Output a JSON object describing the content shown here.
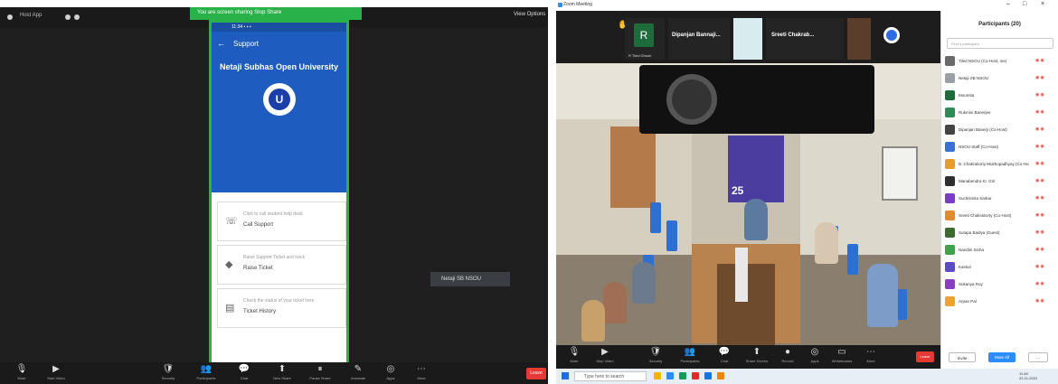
{
  "left": {
    "window_title": "Host App",
    "share_banner": "You are screen sharing   Stop Share",
    "view_label": "View Options",
    "phone": {
      "header_title": "Support",
      "university": "Netaji Subhas Open University",
      "logo_letter": "U",
      "cards": [
        {
          "icon": "phone-icon",
          "label": "Click to call student help desk",
          "value": "Call Support"
        },
        {
          "icon": "ticket-icon",
          "label": "Raise Support Ticket and track",
          "value": "Raise Ticket"
        },
        {
          "icon": "book-icon",
          "label": "Check the status of your ticket here",
          "value": "Ticket History"
        }
      ]
    },
    "name_tag": "Netaji SB NSOU",
    "toolbar": [
      {
        "name": "unmute",
        "glyph": "🎙",
        "label": "Mute"
      },
      {
        "name": "video",
        "glyph": "▶",
        "label": "Start Video"
      },
      {
        "name": "security",
        "glyph": "🛡",
        "label": "Security"
      },
      {
        "name": "participants",
        "glyph": "👥",
        "label": "Participants"
      },
      {
        "name": "chat",
        "glyph": "💬",
        "label": "Chat"
      },
      {
        "name": "new-share",
        "glyph": "⬆",
        "label": "New Share"
      },
      {
        "name": "pause-share",
        "glyph": "⏸",
        "label": "Pause Share"
      },
      {
        "name": "annotate",
        "glyph": "✎",
        "label": "Annotate"
      },
      {
        "name": "apps",
        "glyph": "◎",
        "label": "Apps"
      },
      {
        "name": "more",
        "glyph": "⋯",
        "label": "More"
      }
    ],
    "end_label": "Leave"
  },
  "right": {
    "window_title": "Zoom Meeting",
    "strip": [
      {
        "name": "R Tiled Ghosh",
        "initial": "R",
        "color": "#1e6b3c"
      },
      {
        "name": "Dipanjan Bannaji...",
        "big": "Dipanjan Bannaji..."
      },
      {
        "name": "Sreeti Chakrab...",
        "big": "Sreeti Chakrab..."
      }
    ],
    "banner_number": "25",
    "toolbar": [
      {
        "name": "mute",
        "glyph": "🎙",
        "label": "Mute"
      },
      {
        "name": "video",
        "glyph": "▶",
        "label": "Stop Video"
      },
      {
        "name": "security",
        "glyph": "🛡",
        "label": "Security"
      },
      {
        "name": "participants",
        "glyph": "👥",
        "label": "Participants"
      },
      {
        "name": "chat",
        "glyph": "💬",
        "label": "Chat"
      },
      {
        "name": "share",
        "glyph": "⬆",
        "label": "Share Screen"
      },
      {
        "name": "record",
        "glyph": "●",
        "label": "Record"
      },
      {
        "name": "apps",
        "glyph": "◎",
        "label": "Apps"
      },
      {
        "name": "whiteboard",
        "glyph": "▭",
        "label": "Whiteboards"
      },
      {
        "name": "more",
        "glyph": "⋯",
        "label": "More"
      }
    ],
    "end_label": "Leave",
    "taskbar": {
      "search_placeholder": "Type here to search",
      "time": "11:48",
      "date": "22-11-2022"
    },
    "participants": {
      "title": "Participants (20)",
      "search_placeholder": "Find a participant",
      "rows": [
        {
          "name": "Tiled NSOU (Co-Host, me)",
          "color": "#6a6a6a"
        },
        {
          "name": "Netaji SB NSOU",
          "color": "#9aa0a6"
        },
        {
          "name": "Moumita",
          "color": "#1e6b3c"
        },
        {
          "name": "Rukmini Banerjee",
          "color": "#2e8b57"
        },
        {
          "name": "Dipanjan Banerji (Co-Host)",
          "color": "#444444"
        },
        {
          "name": "NSOU Staff (Co-Host)",
          "color": "#3a6fd8"
        },
        {
          "name": "B. Chakraborty Mukhopadhyay (Co-Host)",
          "color": "#e69b2a"
        },
        {
          "name": "Manabendra Kr. Giri",
          "color": "#2f2f2f"
        },
        {
          "name": "Suchismita Sarkar",
          "color": "#7b3cc9"
        },
        {
          "name": "Sreeti Chakraborty (Co-Host)",
          "color": "#e28a2e"
        },
        {
          "name": "Sutapa Baidya (Guest)",
          "color": "#3c6b2f"
        },
        {
          "name": "Nandini Sinha",
          "color": "#3fa34d"
        },
        {
          "name": "Kasturi",
          "color": "#5b4cc4"
        },
        {
          "name": "Sukanya Roy",
          "color": "#8a3fc2"
        },
        {
          "name": "Arpan Pal",
          "color": "#f0a22e"
        }
      ],
      "invite_label": "Invite",
      "mute_all_label": "Mute All"
    }
  }
}
